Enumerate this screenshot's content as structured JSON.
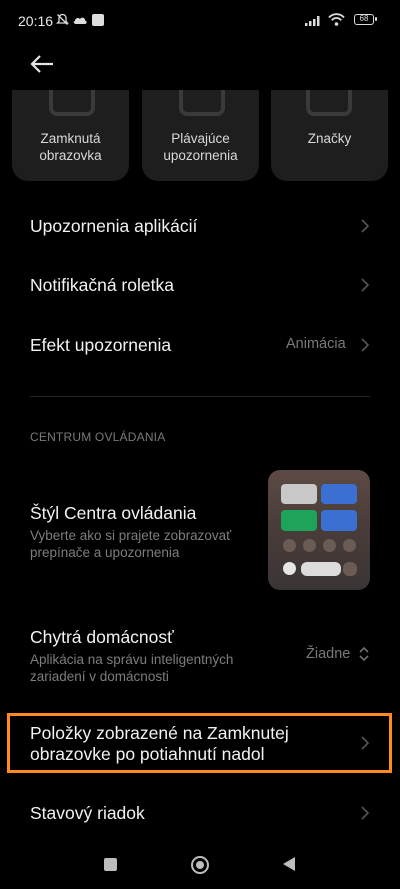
{
  "status_bar": {
    "time": "20:16",
    "battery": "68"
  },
  "tiles": [
    {
      "label_line1": "Zamknutá",
      "label_line2": "obrazovka"
    },
    {
      "label_line1": "Plávajúce",
      "label_line2": "upozornenia"
    },
    {
      "label_line1": "Značky",
      "label_line2": ""
    }
  ],
  "rows": {
    "app_notifications": "Upozornenia aplikácií",
    "notification_shade": "Notifikačná roletka",
    "notification_effect": {
      "title": "Efekt upozornenia",
      "value": "Animácia"
    }
  },
  "control_center": {
    "section_header": "CENTRUM OVLÁDANIA",
    "style": {
      "title": "Štýl Centra ovládania",
      "subtitle_line1": "Vyberte ako si prajete zobrazovať",
      "subtitle_line2": "prepínače a upozornenia"
    },
    "smart_home": {
      "title": "Chytrá domácnosť",
      "subtitle_line1": "Aplikácia na správu inteligentných",
      "subtitle_line2": "zariadení v domácnosti",
      "value": "Žiadne"
    },
    "lockscreen_items": {
      "line1": "Položky zobrazené na Zamknutej",
      "line2": "obrazovke po potiahnutí nadol"
    },
    "status_bar_row": "Stavový riadok"
  },
  "colors": {
    "highlight": "#ff8a1f",
    "tile_blue": "#3b6fd1",
    "tile_green": "#1ea35a"
  }
}
